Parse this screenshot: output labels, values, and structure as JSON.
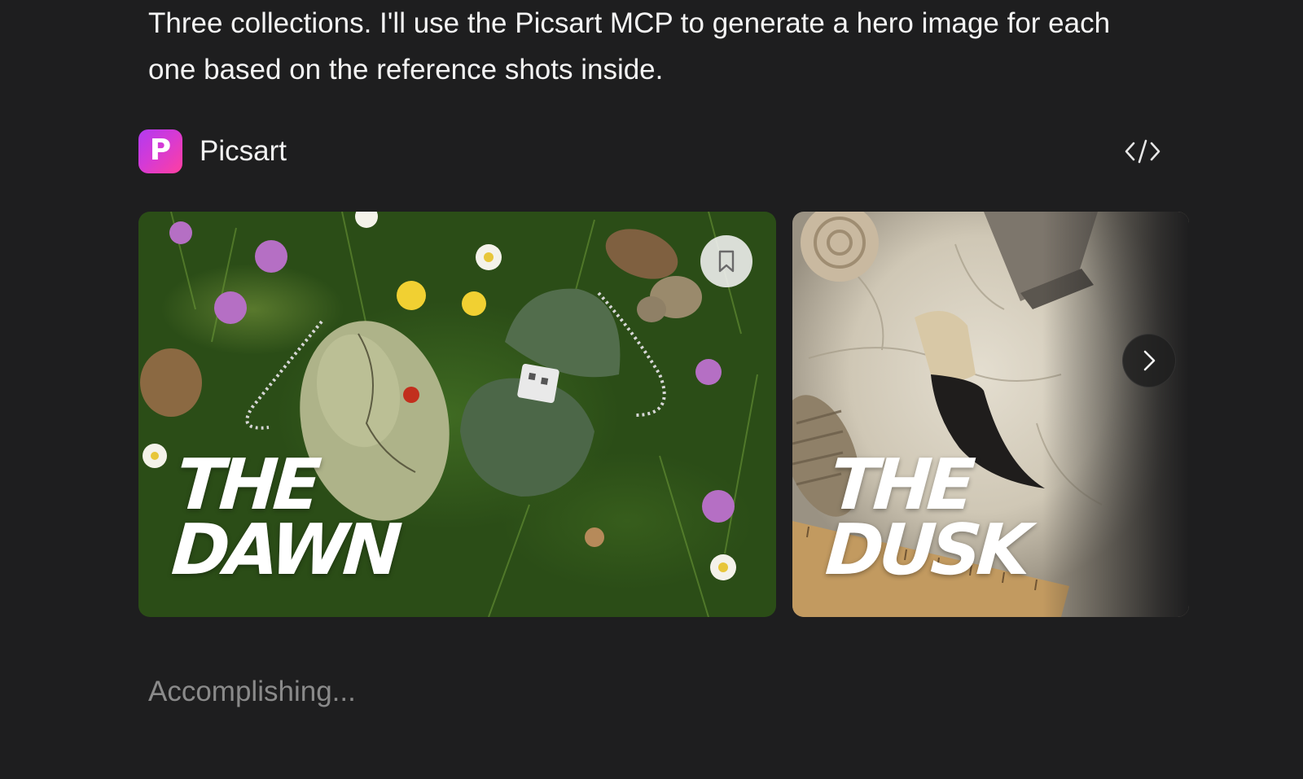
{
  "message": {
    "text": "Three collections. I'll use the Picsart MCP to generate a hero image for each one based on the reference shots inside."
  },
  "tool": {
    "name": "Picsart",
    "logo_letter": "P",
    "code_icon": "code-brackets-icon",
    "brand_gradient": [
      "#b23bf0",
      "#ff3fa0"
    ]
  },
  "carousel": {
    "cards": [
      {
        "title_line1": "THE",
        "title_line2": "DAWN"
      },
      {
        "title_line1": "THE",
        "title_line2": "DUSK"
      }
    ],
    "bookmark_icon": "bookmark-icon",
    "next_icon": "chevron-right-icon"
  },
  "status": {
    "text": "Accomplishing..."
  },
  "colors": {
    "background": "#1e1e1f",
    "text": "#f2f2f2",
    "muted": "#8a8a8a"
  }
}
